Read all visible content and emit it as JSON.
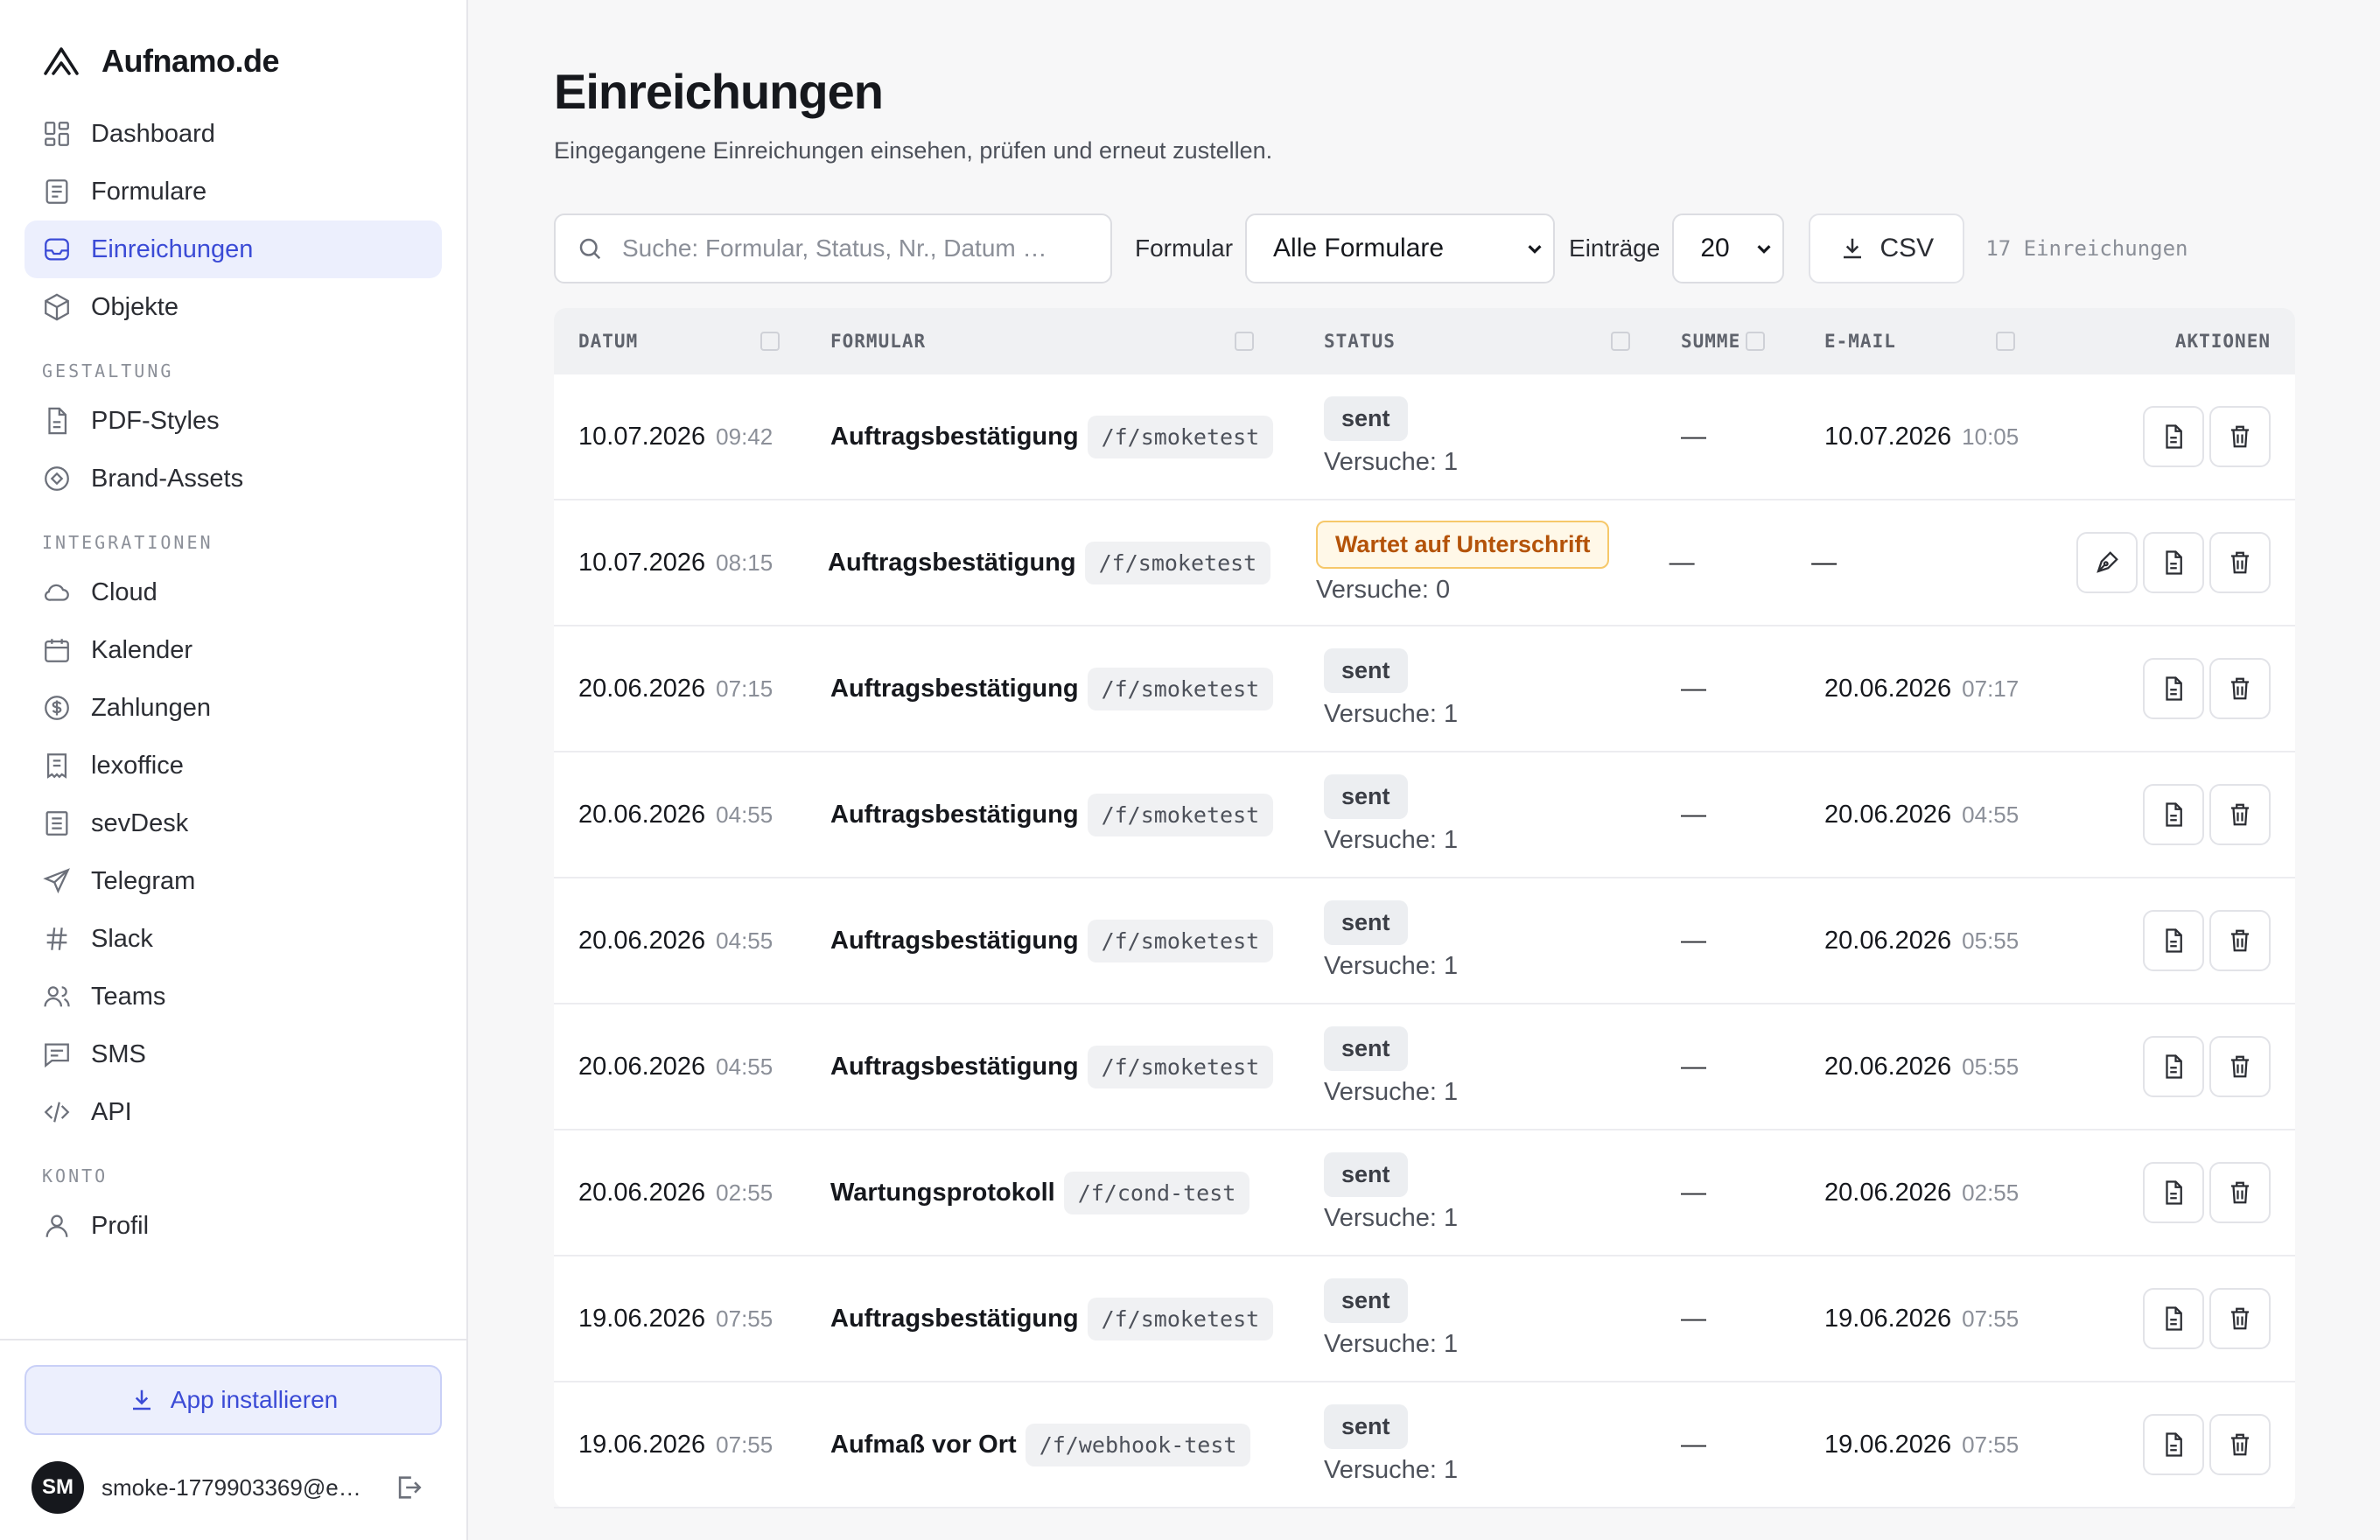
{
  "brand": {
    "name": "Aufnamo.de"
  },
  "nav": {
    "main": [
      {
        "label": "Dashboard",
        "icon": "grid-icon",
        "active": false
      },
      {
        "label": "Formulare",
        "icon": "document-icon",
        "active": false
      },
      {
        "label": "Einreichungen",
        "icon": "inbox-icon",
        "active": true
      },
      {
        "label": "Objekte",
        "icon": "cube-icon",
        "active": false
      }
    ],
    "section_gestaltung": "GESTALTUNG",
    "gestaltung": [
      {
        "label": "PDF-Styles",
        "icon": "file-icon"
      },
      {
        "label": "Brand-Assets",
        "icon": "target-icon"
      }
    ],
    "section_integrationen": "INTEGRATIONEN",
    "integrationen": [
      {
        "label": "Cloud",
        "icon": "cloud-icon"
      },
      {
        "label": "Kalender",
        "icon": "calendar-icon"
      },
      {
        "label": "Zahlungen",
        "icon": "dollar-icon"
      },
      {
        "label": "lexoffice",
        "icon": "receipt-icon"
      },
      {
        "label": "sevDesk",
        "icon": "ledger-icon"
      },
      {
        "label": "Telegram",
        "icon": "send-icon"
      },
      {
        "label": "Slack",
        "icon": "hash-icon"
      },
      {
        "label": "Teams",
        "icon": "users-icon"
      },
      {
        "label": "SMS",
        "icon": "message-icon"
      },
      {
        "label": "API",
        "icon": "code-icon"
      }
    ],
    "section_konto": "KONTO",
    "konto": [
      {
        "label": "Profil",
        "icon": "user-icon"
      }
    ]
  },
  "sidebar_footer": {
    "install_label": "App installieren",
    "avatar_initials": "SM",
    "user_email": "smoke-1779903369@ex..."
  },
  "page": {
    "title": "Einreichungen",
    "subtitle": "Eingegangene Einreichungen einsehen, prüfen und erneut zustellen."
  },
  "toolbar": {
    "search_placeholder": "Suche: Formular, Status, Nr., Datum …",
    "form_label": "Formular",
    "form_selected": "Alle Formulare",
    "entries_label": "Einträge",
    "entries_selected": "20",
    "csv_label": "CSV",
    "count_text": "17 Einreichungen"
  },
  "table": {
    "headers": {
      "datum": "DATUM",
      "formular": "FORMULAR",
      "status": "STATUS",
      "summe": "SUMME",
      "email": "E-MAIL",
      "aktionen": "AKTIONEN"
    },
    "rows": [
      {
        "date": "10.07.2026",
        "time": "09:42",
        "form": "Auftragsbestätigung",
        "path": "/f/smoketest",
        "status": "sent",
        "attempts": "Versuche: 1",
        "sum": "—",
        "mail_date": "10.07.2026",
        "mail_time": "10:05",
        "sign_action": false
      },
      {
        "date": "10.07.2026",
        "time": "08:15",
        "form": "Auftragsbestätigung",
        "path": "/f/smoketest",
        "status": "Wartet auf Unterschrift",
        "attempts": "Versuche: 0",
        "sum": "—",
        "mail_date": "—",
        "mail_time": "",
        "sign_action": true
      },
      {
        "date": "20.06.2026",
        "time": "07:15",
        "form": "Auftragsbestätigung",
        "path": "/f/smoketest",
        "status": "sent",
        "attempts": "Versuche: 1",
        "sum": "—",
        "mail_date": "20.06.2026",
        "mail_time": "07:17",
        "sign_action": false
      },
      {
        "date": "20.06.2026",
        "time": "04:55",
        "form": "Auftragsbestätigung",
        "path": "/f/smoketest",
        "status": "sent",
        "attempts": "Versuche: 1",
        "sum": "—",
        "mail_date": "20.06.2026",
        "mail_time": "04:55",
        "sign_action": false
      },
      {
        "date": "20.06.2026",
        "time": "04:55",
        "form": "Auftragsbestätigung",
        "path": "/f/smoketest",
        "status": "sent",
        "attempts": "Versuche: 1",
        "sum": "—",
        "mail_date": "20.06.2026",
        "mail_time": "05:55",
        "sign_action": false
      },
      {
        "date": "20.06.2026",
        "time": "04:55",
        "form": "Auftragsbestätigung",
        "path": "/f/smoketest",
        "status": "sent",
        "attempts": "Versuche: 1",
        "sum": "—",
        "mail_date": "20.06.2026",
        "mail_time": "05:55",
        "sign_action": false
      },
      {
        "date": "20.06.2026",
        "time": "02:55",
        "form": "Wartungsprotokoll",
        "path": "/f/cond-test",
        "status": "sent",
        "attempts": "Versuche: 1",
        "sum": "—",
        "mail_date": "20.06.2026",
        "mail_time": "02:55",
        "sign_action": false
      },
      {
        "date": "19.06.2026",
        "time": "07:55",
        "form": "Auftragsbestätigung",
        "path": "/f/smoketest",
        "status": "sent",
        "attempts": "Versuche: 1",
        "sum": "—",
        "mail_date": "19.06.2026",
        "mail_time": "07:55",
        "sign_action": false
      },
      {
        "date": "19.06.2026",
        "time": "07:55",
        "form": "Aufmaß vor Ort",
        "path": "/f/webhook-test",
        "status": "sent",
        "attempts": "Versuche: 1",
        "sum": "—",
        "mail_date": "19.06.2026",
        "mail_time": "07:55",
        "sign_action": false
      }
    ]
  },
  "colors": {
    "accent": "#3b4bd6",
    "accent_bg": "#eceffd",
    "warning_text": "#b45309",
    "warning_border": "#f6c86a"
  }
}
